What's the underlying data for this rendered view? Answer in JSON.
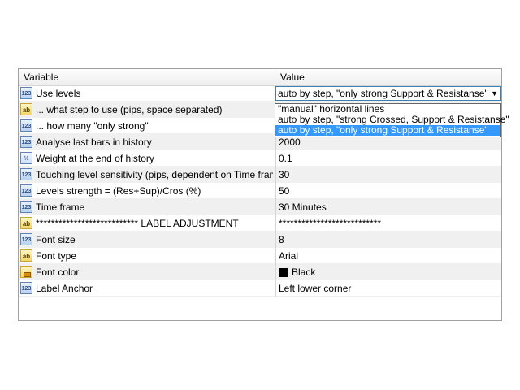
{
  "header": {
    "variable": "Variable",
    "value": "Value"
  },
  "rows": [
    {
      "name": "Use levels",
      "value": "auto by step, \"only strong Support & Resistanse\"",
      "icon": "numeric-icon"
    },
    {
      "name": "... what step to use (pips, space separated)",
      "value": "",
      "icon": "string-icon"
    },
    {
      "name": "... how many \"only strong\"",
      "value": "",
      "icon": "numeric-icon"
    },
    {
      "name": "Analyse last bars in history",
      "value": "2000",
      "icon": "numeric-icon"
    },
    {
      "name": "Weight at the end of history",
      "value": "0.1",
      "icon": "fraction-icon"
    },
    {
      "name": "Touching level sensitivity (pips, dependent on Time frame)",
      "value": "30",
      "icon": "numeric-icon"
    },
    {
      "name": "Levels strength = (Res+Sup)/Cros (%)",
      "value": "50",
      "icon": "numeric-icon"
    },
    {
      "name": "Time frame",
      "value": "30 Minutes",
      "icon": "numeric-icon"
    },
    {
      "name": "*************************** LABEL ADJUSTMENT",
      "value": "***************************",
      "icon": "string-icon"
    },
    {
      "name": "Font size",
      "value": "8",
      "icon": "numeric-icon"
    },
    {
      "name": "Font type",
      "value": "Arial",
      "icon": "string-icon"
    },
    {
      "name": "Font color",
      "value": "Black",
      "icon": "color-icon"
    },
    {
      "name": "Label Anchor",
      "value": "Left lower corner",
      "icon": "numeric-icon"
    }
  ],
  "dropdown": {
    "options": [
      "\"manual\" horizontal lines",
      "auto by step, \"strong Crossed, Support & Resistanse\"",
      "auto by step, \"only strong Support & Resistanse\""
    ],
    "selected_index": 2
  },
  "icon_labels": {
    "numeric": "123",
    "string": "ab",
    "fraction": "½"
  },
  "colors": {
    "selection": "#3399ff",
    "font_color_swatch": "#000000"
  }
}
